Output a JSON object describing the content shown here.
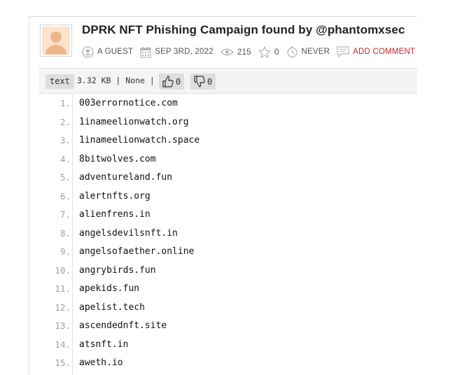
{
  "paste": {
    "title": "DPRK NFT Phishing Campaign found by @phantomxsec",
    "author": "A GUEST",
    "date": "SEP 3RD, 2022",
    "views": "215",
    "rating": "0",
    "expires": "NEVER",
    "add_comment": "ADD COMMENT"
  },
  "toolbar": {
    "syntax": "text",
    "info": "3.32 KB | None |",
    "likes": "0",
    "dislikes": "0"
  },
  "lines": [
    {
      "num": "1.",
      "text": "003errornotice.com"
    },
    {
      "num": "2.",
      "text": "1inameelionwatch.org"
    },
    {
      "num": "3.",
      "text": "1inameelionwatch.space"
    },
    {
      "num": "4.",
      "text": "8bitwolves.com"
    },
    {
      "num": "5.",
      "text": "adventureland.fun"
    },
    {
      "num": "6.",
      "text": "alertnfts.org"
    },
    {
      "num": "7.",
      "text": "alienfrens.in"
    },
    {
      "num": "8.",
      "text": "angelsdevilsnft.in"
    },
    {
      "num": "9.",
      "text": "angelsofaether.online"
    },
    {
      "num": "10.",
      "text": "angrybirds.fun"
    },
    {
      "num": "11.",
      "text": "apekids.fun"
    },
    {
      "num": "12.",
      "text": "apelist.tech"
    },
    {
      "num": "13.",
      "text": "ascendednft.site"
    },
    {
      "num": "14.",
      "text": "atsnft.in"
    },
    {
      "num": "15.",
      "text": "aweth.io"
    }
  ]
}
